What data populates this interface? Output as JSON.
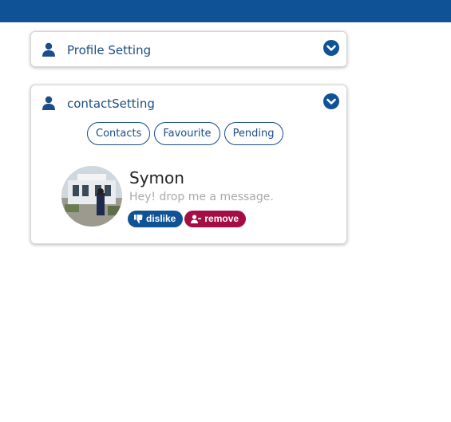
{
  "colors": {
    "brand": "#0f5295",
    "title": "#1b4d86",
    "danger": "#a50e44",
    "muted_text": "#a9a9a9"
  },
  "profile_card": {
    "title": "Profile Setting",
    "icon": "person-icon",
    "toggle_icon": "chevron-down-circle-icon"
  },
  "contact_card": {
    "title": "contactSetting",
    "icon": "person-icon",
    "toggle_icon": "chevron-down-circle-icon",
    "tabs": [
      {
        "label": "Contacts"
      },
      {
        "label": "Favourite"
      },
      {
        "label": "Pending"
      }
    ],
    "contact": {
      "name": "Symon",
      "status": "Hey! drop me a message.",
      "actions": [
        {
          "label": "dislike",
          "icon": "thumbs-down-icon",
          "color": "#0f5295"
        },
        {
          "label": "remove",
          "icon": "user-minus-icon",
          "color": "#a50e44"
        }
      ]
    }
  }
}
